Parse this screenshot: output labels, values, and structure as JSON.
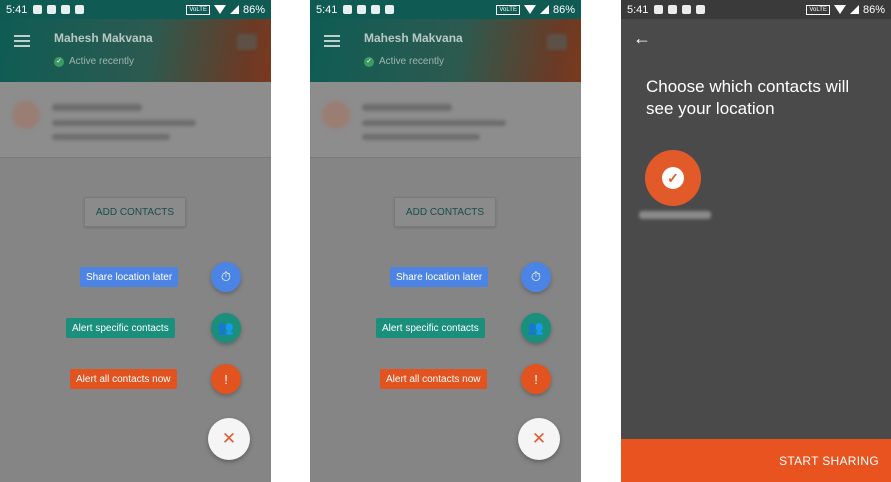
{
  "status_bar": {
    "time": "5:41",
    "network": "VoLTE",
    "battery": "86%"
  },
  "screens": [
    {
      "header": {
        "name": "Mahesh Makvana",
        "status": "Active recently"
      },
      "add_contacts_label": "ADD CONTACTS",
      "fab_menu": {
        "share_later": "Share location later",
        "alert_specific": "Alert specific contacts",
        "alert_all": "Alert all contacts now"
      }
    },
    {
      "header": {
        "name": "Mahesh Makvana",
        "status": "Active recently"
      },
      "add_contacts_label": "ADD CONTACTS",
      "fab_menu": {
        "share_later": "Share location later",
        "alert_specific": "Alert specific contacts",
        "alert_all": "Alert all contacts now"
      }
    },
    {
      "title": "Choose which contacts will see your location",
      "start_sharing_label": "START SHARING"
    }
  ],
  "colors": {
    "share_later": "#4c84e6",
    "alert_specific": "#1a8f7c",
    "alert_all": "#e2531f",
    "accent": "#e8531f"
  },
  "icons": {
    "menu": "menu-icon",
    "timer": "timer-icon",
    "group": "group-icon",
    "alert": "alert-icon",
    "close": "close-icon",
    "back": "back-arrow-icon"
  }
}
